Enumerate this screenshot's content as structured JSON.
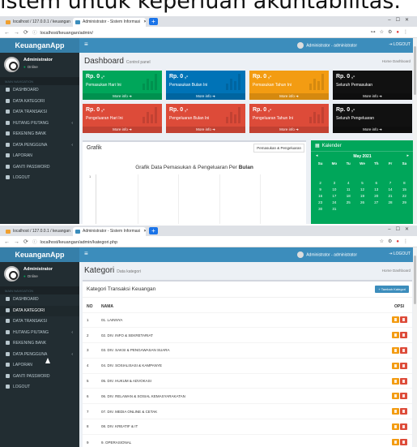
{
  "caption": "istem untuk keperluan akuntabilitas.",
  "screen1": {
    "tabs": [
      "localhost / 127.0.0.1 / keuangan",
      "Administrator - Sistem Informasi"
    ],
    "url": "localhost/keuangan/admin/",
    "app_title": "KeuanganApp",
    "user_label": "Administrator - administrator",
    "logout_label": "LOGOUT",
    "profile_name": "Administrator",
    "profile_status": "Online",
    "nav_header": "MAIN NAVIGATION",
    "menu": [
      "DASHBOARD",
      "DATA KATEGORI",
      "DATA TRANSAKSI",
      "HUTANG PIUTANG",
      "REKENING BANK",
      "DATA PENGGUNA",
      "LAPORAN",
      "GANTI PASSWORD",
      "LOGOUT"
    ],
    "page_title": "Dashboard",
    "page_subtitle": "Control panel",
    "breadcrumb": "Home  Dashboard",
    "tiles": [
      {
        "value": "Rp. 0 ,-",
        "label": "Pemasukan Hari Ini",
        "more": "More info",
        "color": "#00a65a"
      },
      {
        "value": "Rp. 0 ,-",
        "label": "Pemasukan Bulan Ini",
        "more": "More info",
        "color": "#0073b7"
      },
      {
        "value": "Rp. 0 ,-",
        "label": "Pemasukan Tahun Ini",
        "more": "More info",
        "color": "#f39c12"
      },
      {
        "value": "Rp. 0 ,-",
        "label": "Seluruh Pemasukan",
        "more": "More info",
        "color": "#111111"
      },
      {
        "value": "Rp. 0 ,-",
        "label": "Pengeluaran Hari Ini",
        "more": "More info",
        "color": "#dd4b39"
      },
      {
        "value": "Rp. 0 ,-",
        "label": "Pengeluaran Bulan Ini",
        "more": "More info",
        "color": "#dd4b39"
      },
      {
        "value": "Rp. 0 ,-",
        "label": "Pengeluaran Tahun Ini",
        "more": "More info",
        "color": "#dd4b39"
      },
      {
        "value": "Rp. 0 ,-",
        "label": "Seluruh Pengeluaran",
        "more": "More info",
        "color": "#111111"
      }
    ],
    "grafik_title": "Grafik",
    "grafik_tab": "Pemasukan & Pengeluaran",
    "chart_title": "Grafik Data Pemasukan & Pengeluaran Per",
    "chart_title_bold": "Bulan",
    "chart_ytick": "1",
    "calendar_title": "Kalender",
    "calendar_month": "May 2021",
    "calendar_days": [
      "Su",
      "Mo",
      "Tu",
      "We",
      "Th",
      "Fr",
      "Sa"
    ],
    "calendar_dates": [
      "2",
      "3",
      "4",
      "5",
      "6",
      "7",
      "8",
      "9",
      "10",
      "11",
      "12",
      "13",
      "14",
      "15",
      "16",
      "17",
      "18",
      "19",
      "20",
      "21",
      "22",
      "23",
      "24",
      "25",
      "26",
      "27",
      "28",
      "29",
      "30",
      "31"
    ]
  },
  "screen2": {
    "tabs": [
      "localhost / 127.0.0.1 / keuangan",
      "Administrator - Sistem Informasi"
    ],
    "url": "localhost/keuangan/admin/kategori.php",
    "app_title": "KeuanganApp",
    "user_label": "Administrator - administrator",
    "logout_label": "LOGOUT",
    "profile_name": "Administrator",
    "profile_status": "Online",
    "nav_header": "MAIN NAVIGATION",
    "menu": [
      "DASHBOARD",
      "DATA KATEGORI",
      "DATA TRANSAKSI",
      "HUTANG PIUTANG",
      "REKENING BANK",
      "DATA PENGGUNA",
      "LAPORAN",
      "GANTI PASSWORD",
      "LOGOUT"
    ],
    "page_title": "Kategori",
    "page_subtitle": "Data kategori",
    "breadcrumb": "Home  Dashboard",
    "panel_title": "Kategori Transaksi Keuangan",
    "add_button": "+ Tambah Kategori",
    "col_no": "NO",
    "col_nama": "NAMA",
    "col_opsi": "OPSI",
    "rows": [
      {
        "no": "1",
        "nama": "01. LAINNYA"
      },
      {
        "no": "2",
        "nama": "02. DIV. INFO & SEKRETARIAT"
      },
      {
        "no": "3",
        "nama": "03. DIV. SAKSI & PENGAWASAN SUARA"
      },
      {
        "no": "4",
        "nama": "04. DIV. SOSIALISASI & KAMPANYE"
      },
      {
        "no": "5",
        "nama": "05. DIV. HUKUM & ADVOKASI"
      },
      {
        "no": "6",
        "nama": "06. DIV. RELAWAN & SOSIAL KEMASYARAKATAN"
      },
      {
        "no": "7",
        "nama": "07. DIV. MEDIA ONLINE & CETAK"
      },
      {
        "no": "8",
        "nama": "08. DIV. KREATIF & IT"
      },
      {
        "no": "9",
        "nama": "9. OPERASIONAL"
      }
    ]
  }
}
